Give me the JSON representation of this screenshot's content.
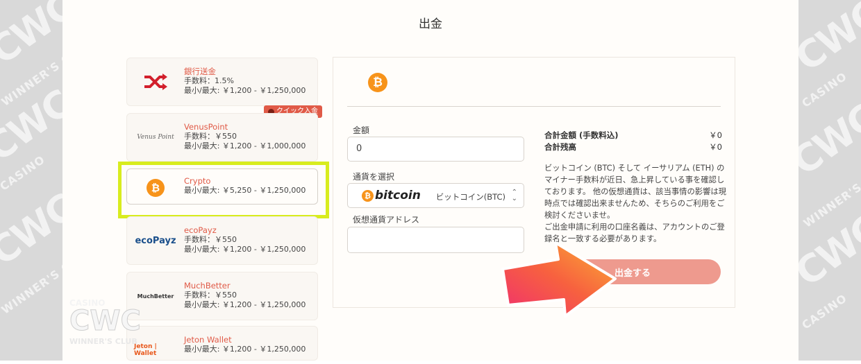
{
  "page": {
    "title": "出金"
  },
  "watermark": {
    "brand_big": "CWC",
    "brand_small_1": "CASINO",
    "brand_small_2": "WINNER'S CLUB"
  },
  "methods": [
    {
      "name": "銀行送金",
      "fee": "手数料：1.5%",
      "limit": "最小/最大: ￥1,200 - ￥1,250,000",
      "icon": "shuffle-icon"
    },
    {
      "name": "VenusPoint",
      "fee": "手数料：￥550",
      "limit": "最小/最大: ￥1,200 - ￥1,000,000",
      "icon": "venus-point-logo",
      "logo_text": "Venus Point"
    },
    {
      "name": "Crypto",
      "limit": "最小/最大: ￥5,250 - ￥1,250,000",
      "icon": "bitcoin-icon"
    },
    {
      "name": "ecoPayz",
      "fee": "手数料：￥550",
      "limit": "最小/最大: ￥1,200 - ￥1,250,000",
      "icon": "ecopayz-logo",
      "logo_text": "ecoPayz"
    },
    {
      "name": "MuchBetter",
      "fee": "手数料：￥550",
      "limit": "最小/最大: ￥1,200 - ￥1,250,000",
      "icon": "muchbetter-logo",
      "logo_text": "MuchBetter"
    },
    {
      "name": "Jeton Wallet",
      "limit": "最小/最大: ￥1,200 - ￥1,250,000",
      "icon": "jeton-logo",
      "logo_text": "Jeton | Wallet"
    }
  ],
  "quick_badge": "クイック入金",
  "form": {
    "amount_label": "金額",
    "amount_value": "0",
    "currency_label": "通貨を選択",
    "currency_logo": "bitcoin",
    "currency_selected": "ビットコイン(BTC)",
    "address_label": "仮想通貨アドレス",
    "address_value": ""
  },
  "summary": {
    "total_label": "合計金額 (手数料込)",
    "total_value": "￥0",
    "balance_label": "合計残高",
    "balance_value": "￥0",
    "note_1": "ビットコイン (BTC) そして イーサリアム (ETH) のマイナー手数料が近日、急上昇している事を確認しております。 他の仮想通貨は、該当事情の影響は現時点では確認出来ませんため、そちらのご利用をご検討くださいませ。",
    "note_2": "ご出金申請に利用の口座名義は、アカウントのご登録名と一致する必要があります。"
  },
  "withdraw_button": "出金する",
  "colors": {
    "accent": "#e05a47",
    "button": "#ee9a8e",
    "highlight": "#d8ec1e",
    "bitcoin": "#f7931a"
  }
}
